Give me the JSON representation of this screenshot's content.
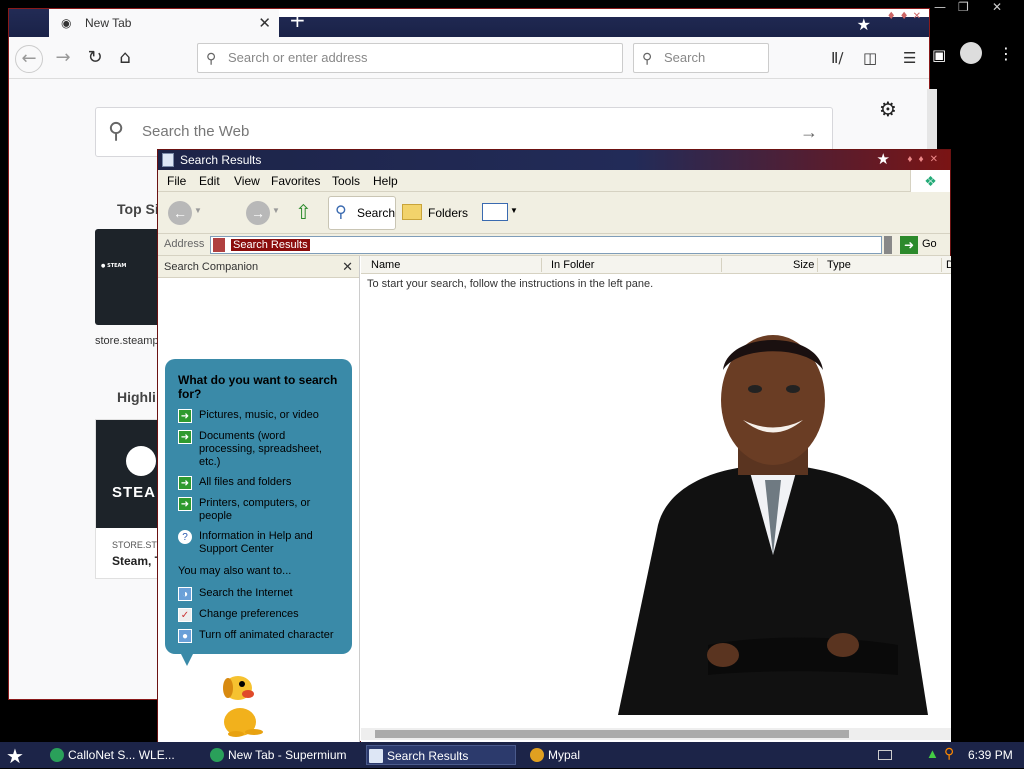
{
  "browser": {
    "tab_title": "New Tab",
    "url_placeholder": "Search or enter address",
    "search_placeholder": "Search",
    "main_search_placeholder": "Search the Web",
    "top_sites_title": "Top Sit",
    "top_site_label": "store.steamp",
    "highlights_title": "Highli",
    "highlight_site": "STORE.STE",
    "highlight_title": "Steam, T",
    "steam_word": "STEA"
  },
  "explorer": {
    "title": "Search Results",
    "menu": [
      "File",
      "Edit",
      "View",
      "Favorites",
      "Tools",
      "Help"
    ],
    "toolbar": {
      "search_label": "Search",
      "folders_label": "Folders"
    },
    "address_label": "Address",
    "address_value": "Search Results",
    "go_label": "Go",
    "companion_title": "Search Companion",
    "question": "What do you want to search for?",
    "options": [
      "Pictures, music, or video",
      "Documents (word processing, spreadsheet, etc.)",
      "All files and folders",
      "Printers, computers, or people",
      "Information in Help and Support Center"
    ],
    "also_title": "You may also want to...",
    "also_options": [
      "Search the Internet",
      "Change preferences",
      "Turn off animated character"
    ],
    "columns": [
      "Name",
      "In Folder",
      "Size",
      "Type",
      "D"
    ],
    "hint": "To start your search, follow the instructions in the left pane."
  },
  "taskbar": {
    "items": [
      "CalloNet S... WLE...",
      "New Tab - Supermium",
      "Search Results",
      "Mypal"
    ],
    "clock": "6:39 PM"
  }
}
